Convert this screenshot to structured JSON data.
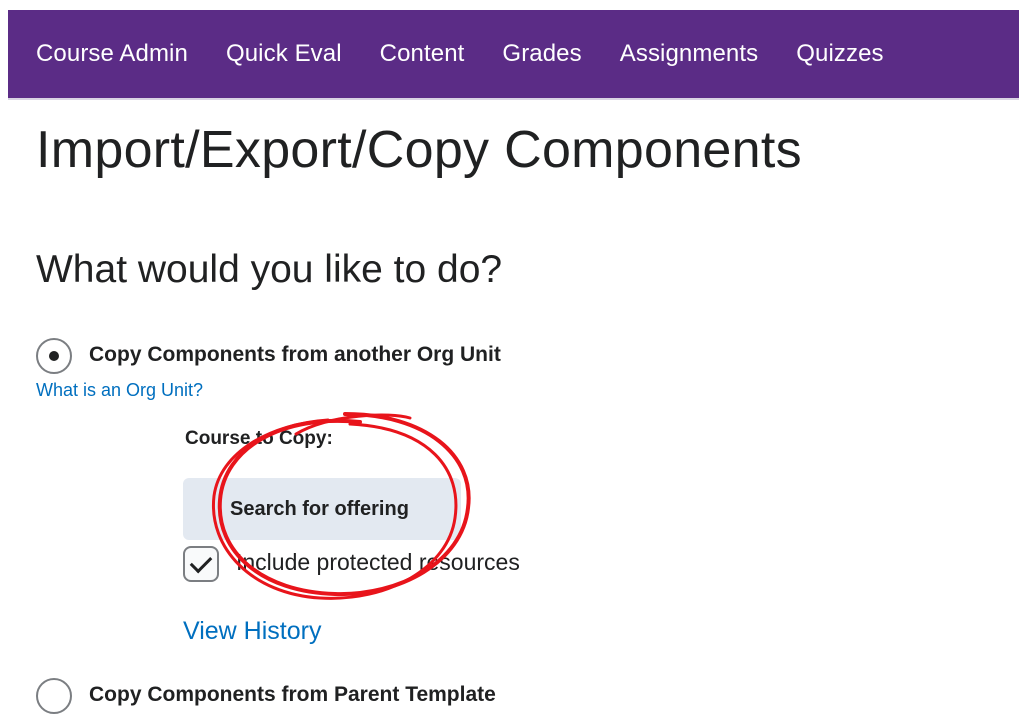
{
  "navbar": {
    "items": [
      "Course Admin",
      "Quick Eval",
      "Content",
      "Grades",
      "Assignments",
      "Quizzes"
    ]
  },
  "page": {
    "title": "Import/Export/Copy Components",
    "section_title": "What would you like to do?"
  },
  "options": {
    "copy_org_unit": {
      "label": "Copy Components from another Org Unit",
      "selected": true,
      "help_link": "What is an Org Unit?",
      "course_to_copy_label": "Course to Copy:",
      "search_button": "Search for offering",
      "include_protected_label": "Include protected resources",
      "include_protected_checked": true,
      "view_history_link": "View History"
    },
    "copy_parent_template": {
      "label": "Copy Components from Parent Template",
      "selected": false
    }
  },
  "colors": {
    "nav_background": "#5b2c86",
    "link": "#006fbf",
    "annotation": "#e8141b",
    "button_background": "#e3e9f1"
  }
}
